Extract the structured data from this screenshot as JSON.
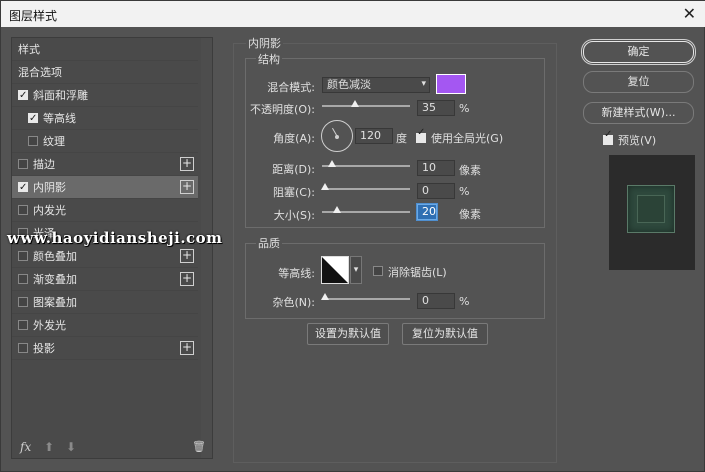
{
  "window": {
    "title": "图层样式",
    "close": "✕"
  },
  "left": {
    "items": [
      {
        "label": "样式",
        "checkbox": false,
        "checked": false,
        "plus": false,
        "selected": false
      },
      {
        "label": "混合选项",
        "checkbox": false,
        "checked": false,
        "plus": false,
        "selected": false
      },
      {
        "label": "斜面和浮雕",
        "checkbox": true,
        "checked": true,
        "plus": false,
        "selected": false
      },
      {
        "label": "等高线",
        "checkbox": true,
        "checked": true,
        "plus": false,
        "selected": false
      },
      {
        "label": "纹理",
        "checkbox": true,
        "checked": false,
        "plus": false,
        "selected": false
      },
      {
        "label": "描边",
        "checkbox": true,
        "checked": false,
        "plus": true,
        "selected": false
      },
      {
        "label": "内阴影",
        "checkbox": true,
        "checked": true,
        "plus": true,
        "selected": true
      },
      {
        "label": "内发光",
        "checkbox": true,
        "checked": false,
        "plus": false,
        "selected": false
      },
      {
        "label": "光泽",
        "checkbox": true,
        "checked": false,
        "plus": false,
        "selected": false
      },
      {
        "label": "颜色叠加",
        "checkbox": true,
        "checked": false,
        "plus": true,
        "selected": false
      },
      {
        "label": "渐变叠加",
        "checkbox": true,
        "checked": false,
        "plus": true,
        "selected": false
      },
      {
        "label": "图案叠加",
        "checkbox": true,
        "checked": false,
        "plus": false,
        "selected": false
      },
      {
        "label": "外发光",
        "checkbox": true,
        "checked": false,
        "plus": false,
        "selected": false
      },
      {
        "label": "投影",
        "checkbox": true,
        "checked": false,
        "plus": true,
        "selected": false
      }
    ],
    "bottom": {
      "fx": "fx",
      "up": "⬆",
      "down": "⬇",
      "trash": "🗑"
    }
  },
  "panel": {
    "section_title": "内阴影",
    "structure_title": "结构",
    "blend_mode_label": "混合模式:",
    "blend_mode_value": "颜色减淡",
    "shadow_color": "#a457f2",
    "opacity_label": "不透明度(O):",
    "opacity_value": "35",
    "opacity_unit": "%",
    "angle_label": "角度(A):",
    "angle_value": "120",
    "angle_unit": "度",
    "global_light_label": "使用全局光(G)",
    "global_light_checked": true,
    "distance_label": "距离(D):",
    "distance_value": "10",
    "distance_unit": "像素",
    "choke_label": "阻塞(C):",
    "choke_value": "0",
    "choke_unit": "%",
    "size_label": "大小(S):",
    "size_value": "20",
    "size_unit": "像素",
    "quality_title": "品质",
    "contour_label": "等高线:",
    "antialias_label": "消除锯齿(L)",
    "antialias_checked": false,
    "noise_label": "杂色(N):",
    "noise_value": "0",
    "noise_unit": "%",
    "set_default_btn": "设置为默认值",
    "reset_default_btn": "复位为默认值"
  },
  "right": {
    "ok_btn": "确定",
    "reset_btn": "复位",
    "new_style_btn": "新建样式(W)...",
    "preview_label": "预览(V)",
    "preview_checked": true
  },
  "watermark": "www.haoyidiansheji.com"
}
